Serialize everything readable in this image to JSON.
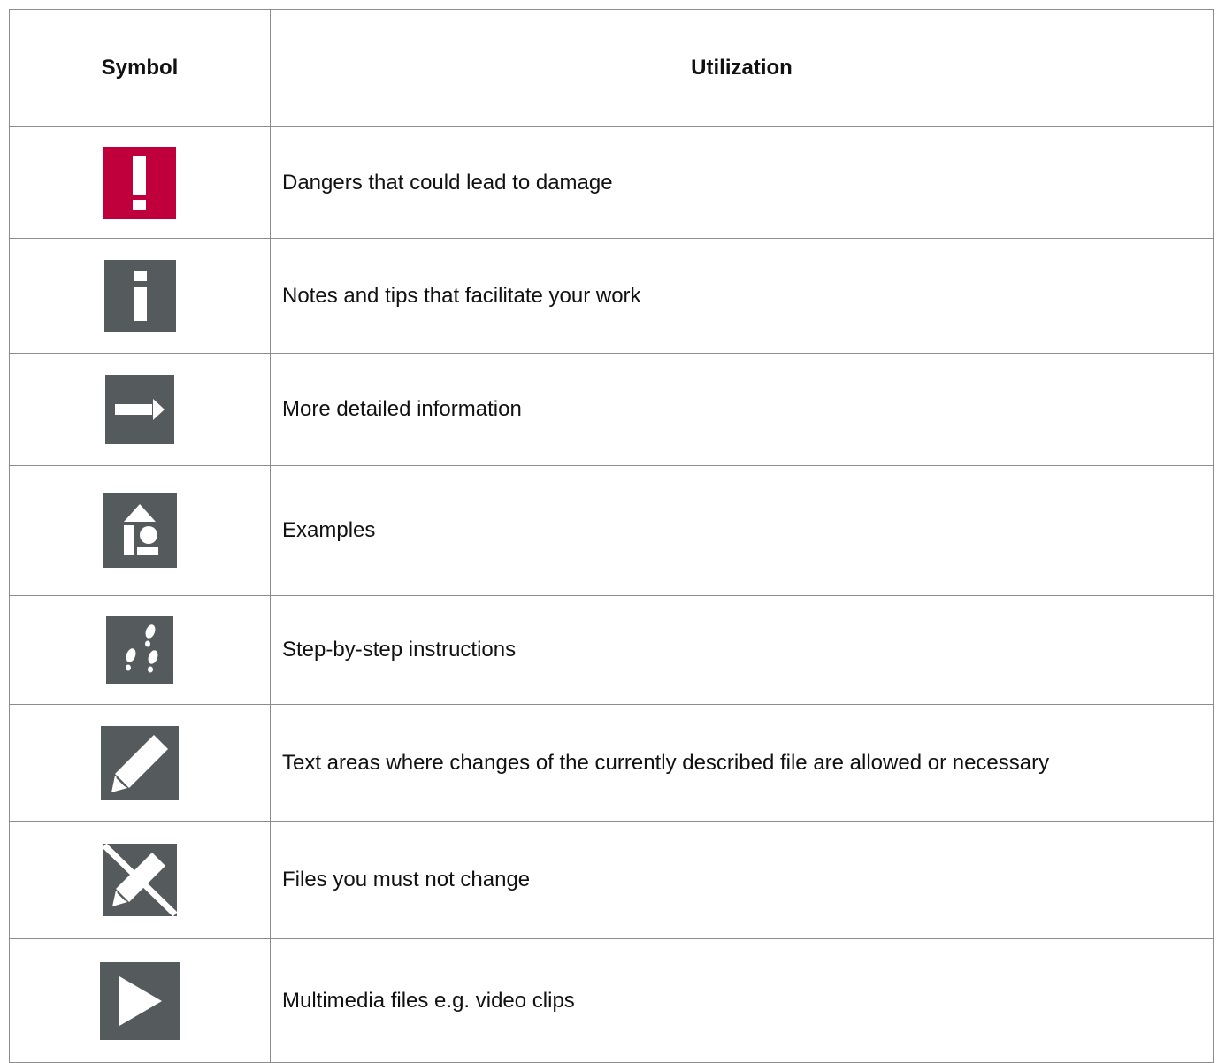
{
  "table": {
    "headers": {
      "symbol": "Symbol",
      "utilization": "Utilization"
    },
    "colors": {
      "danger_red": "#c0003c",
      "icon_gray": "#555a5c",
      "border": "#8c8c8c"
    },
    "rows": [
      {
        "icon": "warning-exclamation-icon",
        "text": "Dangers that could lead to damage"
      },
      {
        "icon": "info-icon",
        "text": "Notes and tips that facilitate your work"
      },
      {
        "icon": "arrow-right-icon",
        "text": "More detailed information"
      },
      {
        "icon": "examples-icon",
        "text": "Examples"
      },
      {
        "icon": "footsteps-icon",
        "text": "Step-by-step instructions"
      },
      {
        "icon": "pencil-icon",
        "text": "Text areas where changes of the currently described file are allowed or necessary"
      },
      {
        "icon": "pencil-crossed-icon",
        "text": "Files you must not change"
      },
      {
        "icon": "play-icon",
        "text": "Multimedia files e.g. video clips"
      }
    ]
  }
}
